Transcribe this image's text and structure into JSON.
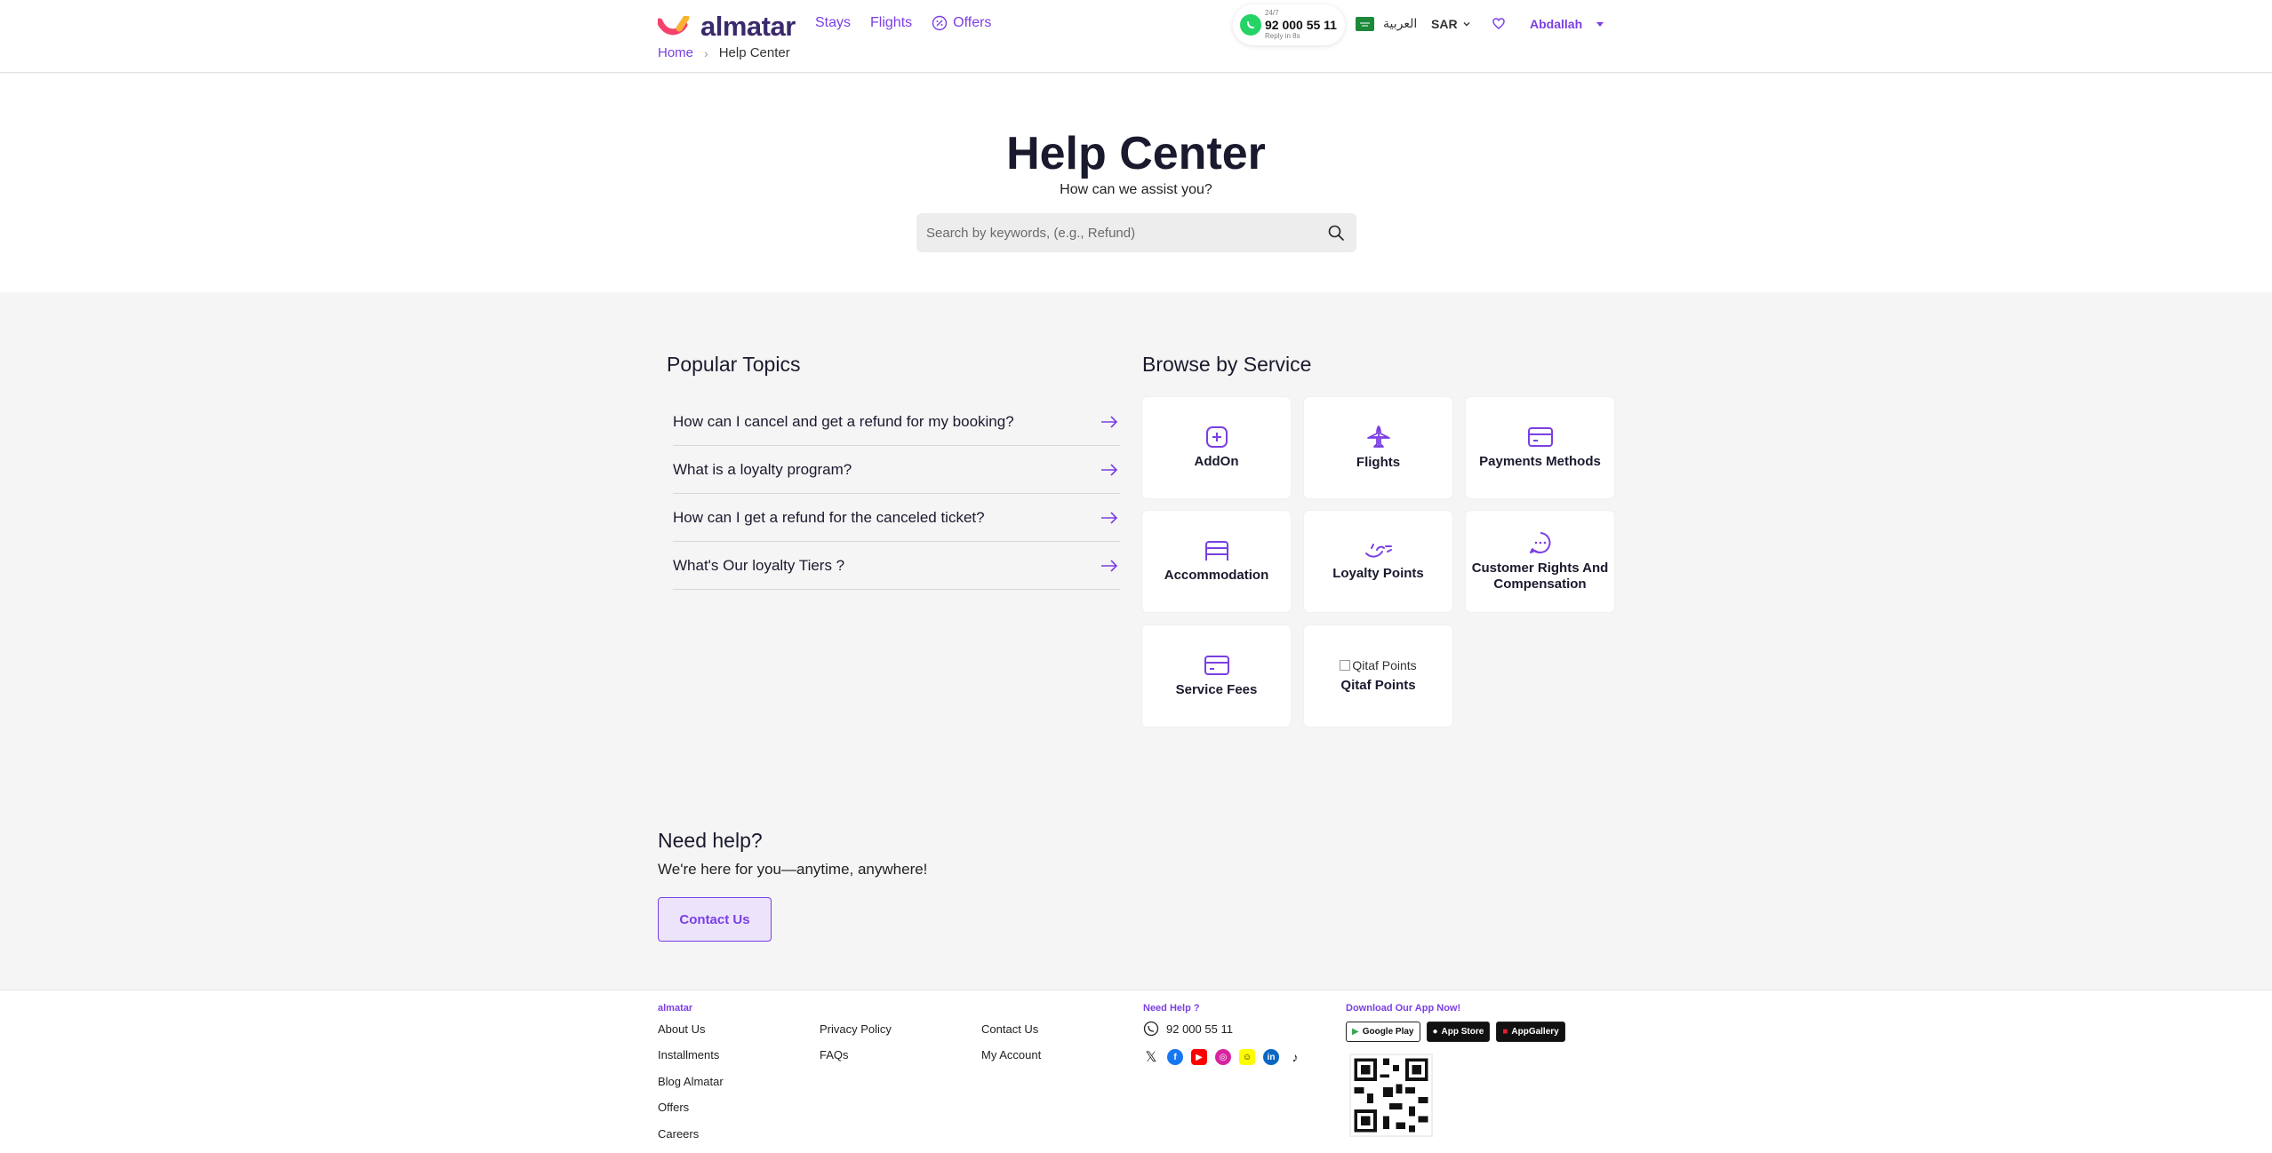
{
  "header": {
    "logo_text": "almatar",
    "nav": [
      {
        "label": "Stays"
      },
      {
        "label": "Flights"
      },
      {
        "label": "Offers"
      }
    ],
    "breadcrumb": {
      "home": "Home",
      "current": "Help Center"
    },
    "whatsapp": {
      "top": "24/7",
      "number": "92 000 55 11",
      "bottom": "Reply in 8s"
    },
    "language": "العربية",
    "currency": "SAR",
    "user": "Abdallah"
  },
  "hero": {
    "title": "Help Center",
    "subtitle": "How can we assist you?",
    "search_placeholder": "Search by keywords, (e.g., Refund)"
  },
  "popular": {
    "title": "Popular Topics",
    "items": [
      "How can I cancel and get a refund for my booking?",
      "What is a loyalty program?",
      "How can I get a refund for the canceled ticket?",
      "What's Our loyalty Tiers ?"
    ]
  },
  "browse": {
    "title": "Browse by Service",
    "services": [
      {
        "label": "AddOn",
        "icon": "plus-square-icon"
      },
      {
        "label": "Flights",
        "icon": "plane-icon"
      },
      {
        "label": "Payments Methods",
        "icon": "credit-card-icon"
      },
      {
        "label": "Accommodation",
        "icon": "bed-icon"
      },
      {
        "label": "Loyalty Points",
        "icon": "loyalty-icon"
      },
      {
        "label": "Customer Rights And Compensation",
        "icon": "chat-icon"
      },
      {
        "label": "Service Fees",
        "icon": "credit-card-icon"
      },
      {
        "label": "Qitaf Points",
        "icon": "broken-image-icon",
        "img_alt": "Qitaf Points"
      }
    ]
  },
  "need_help": {
    "title": "Need help?",
    "subtitle": "We're here for you—anytime, anywhere!",
    "button": "Contact Us"
  },
  "footer": {
    "brand_heading": "almatar",
    "col1": [
      "About Us",
      "Installments",
      "Blog Almatar",
      "Offers",
      "Careers"
    ],
    "col2": [
      "Privacy Policy",
      "FAQs"
    ],
    "col3": [
      "Contact Us",
      "My Account"
    ],
    "help_heading": "Need Help ?",
    "phone": "92 000 55 11",
    "app_heading": "Download Our App Now!",
    "stores": [
      "Google Play",
      "App Store",
      "AppGallery"
    ],
    "colors": {
      "accent": "#7b3fe4"
    }
  }
}
